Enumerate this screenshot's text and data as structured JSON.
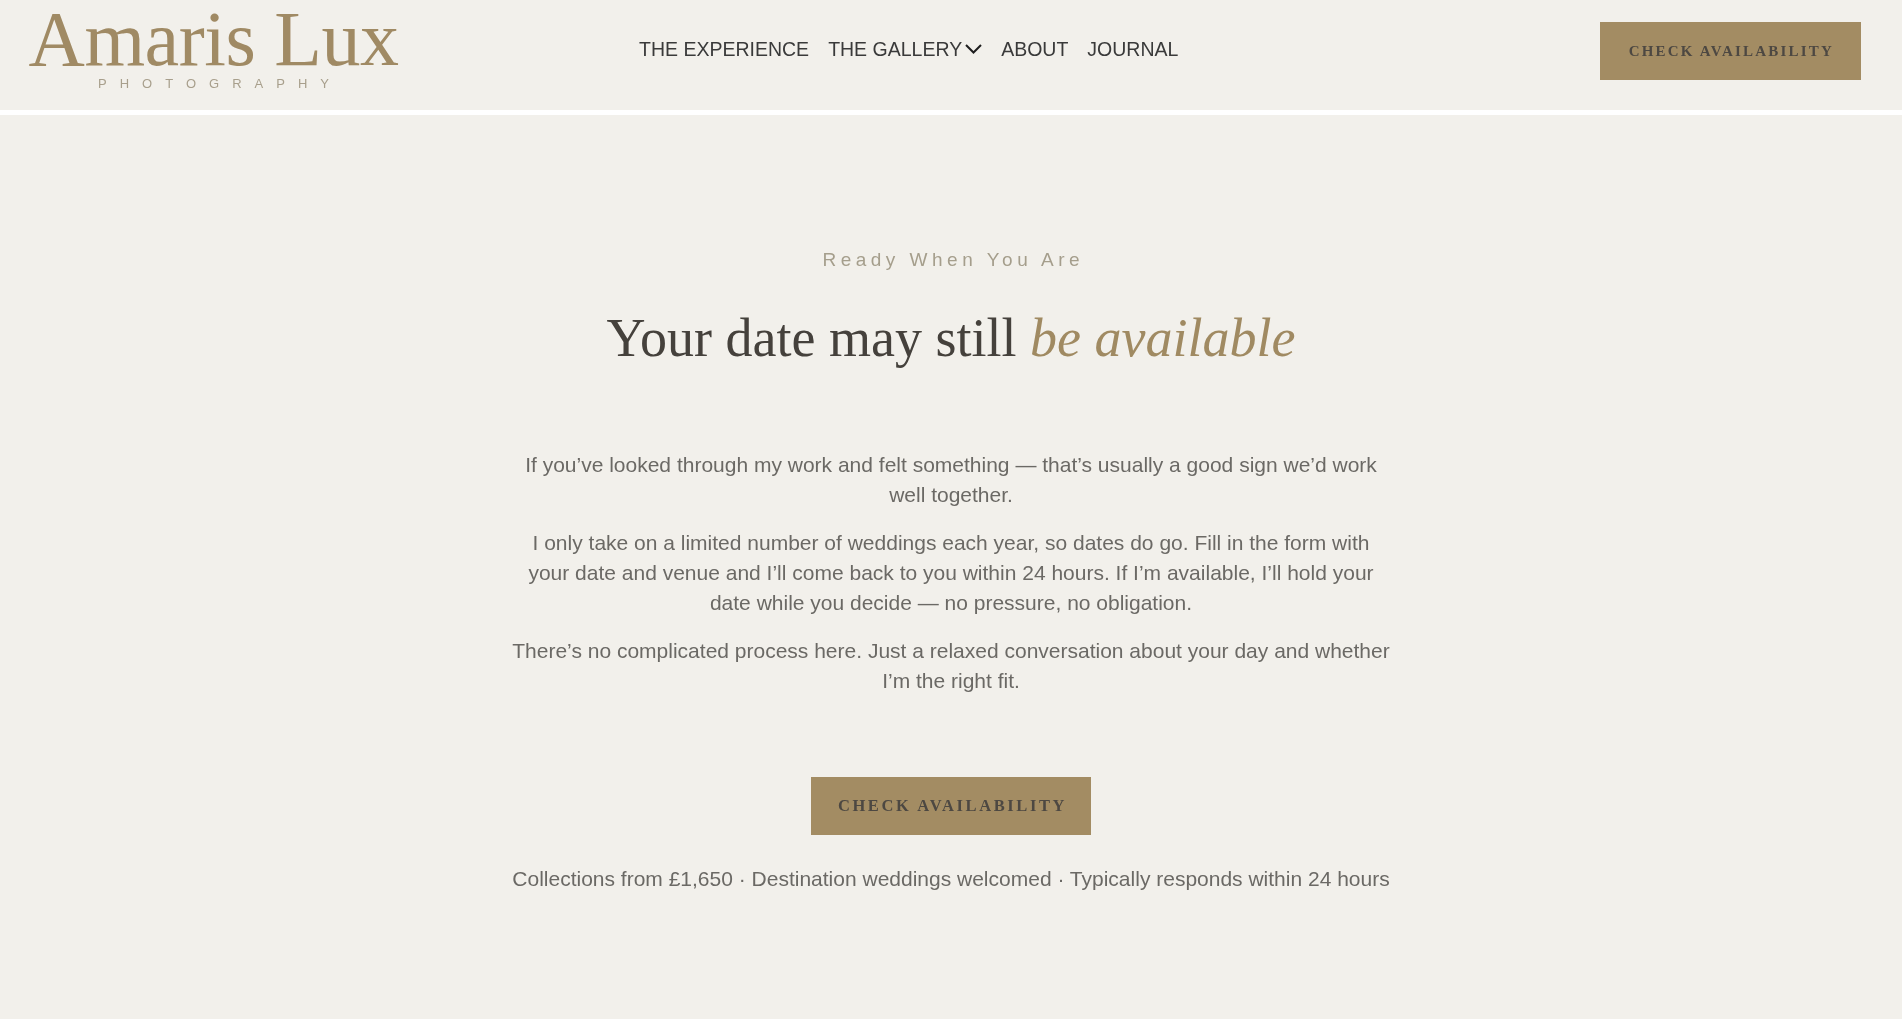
{
  "header": {
    "logo": {
      "wordmark": "Amaris Lux",
      "tagline": "PHOTOGRAPHY"
    },
    "nav": [
      {
        "label": "THE EXPERIENCE",
        "dropdown": false
      },
      {
        "label": "THE GALLERY",
        "dropdown": true
      },
      {
        "label": "ABOUT",
        "dropdown": false
      },
      {
        "label": "JOURNAL",
        "dropdown": false
      }
    ],
    "cta_button": "CHECK AVAILABILITY"
  },
  "hero": {
    "eyebrow": "Ready When You Are",
    "heading": "Your date may still *be available*",
    "paragraphs": [
      "If you’ve looked through my work and felt something — that’s usually a good sign we’d work well together.",
      "I only take on a limited number of weddings each year, so dates do go. Fill in the form with your date and venue and I’ll come back to you within 24 hours. If I’m available, I’ll hold your date while you decide — no pressure, no obligation.",
      "There’s no complicated process here. Just a relaxed conversation about your day and whether I’m the right fit."
    ],
    "cta_button": "CHECK AVAILABILITY",
    "footnote": "Collections from £1,650 · Destination weddings welcomed · Typically responds within 24 hours"
  }
}
